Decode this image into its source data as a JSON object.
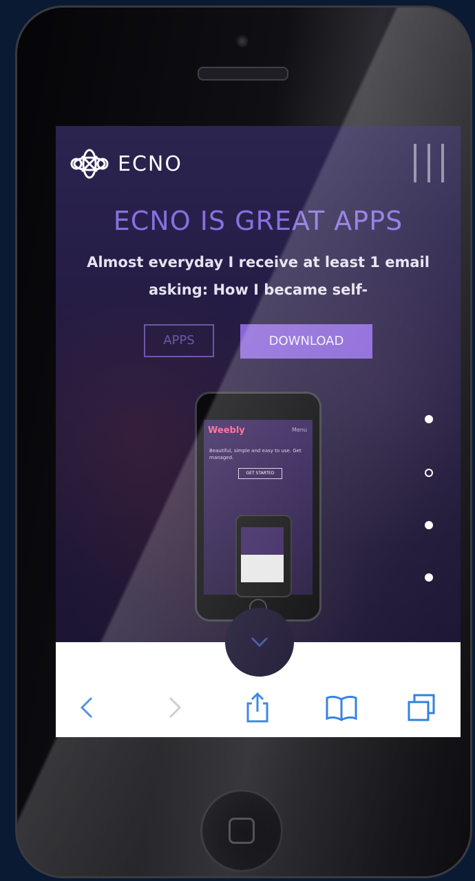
{
  "site": {
    "brand": "ECNO",
    "hero_title": "ECNO IS GREAT APPS",
    "hero_body": "Almost everyday I receive at least 1 email asking: How I became self-",
    "buttons": {
      "apps": "APPS",
      "download": "DOWNLOAD"
    },
    "mini_phone": {
      "brand": "Weebly",
      "menu": "Menu",
      "text": "Beautiful, simple and easy to use. Get managed.",
      "button": "GET STARTED"
    },
    "pagination_dots": [
      "filled",
      "hollow",
      "filled",
      "filled"
    ]
  },
  "browser_toolbar": {
    "icons": [
      "back-icon",
      "forward-icon",
      "share-icon",
      "bookmarks-icon",
      "tabs-icon"
    ],
    "accent_color": "#2f7fe0"
  },
  "colors": {
    "accent": "#8a64d8",
    "title": "#8a6fe0",
    "background": "#0a1a33"
  }
}
